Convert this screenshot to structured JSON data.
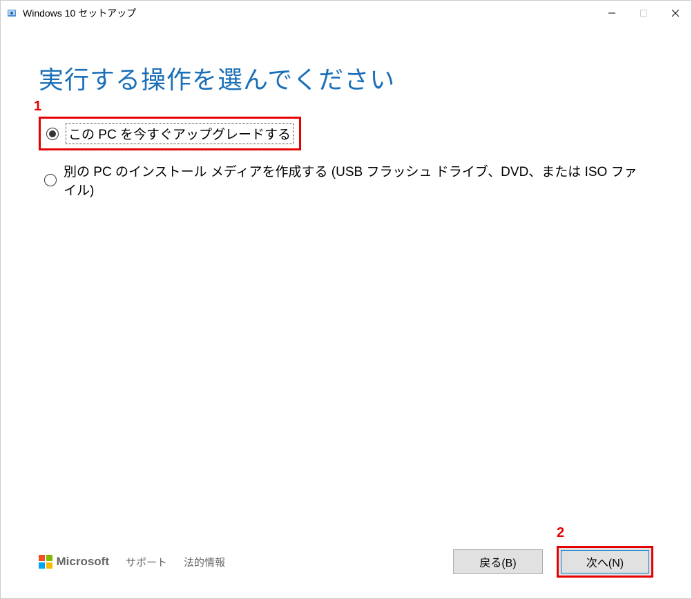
{
  "window": {
    "title": "Windows 10 セットアップ"
  },
  "content": {
    "heading": "実行する操作を選んでください",
    "options": [
      {
        "label": "この PC を今すぐアップグレードする",
        "selected": true
      },
      {
        "label": "別の PC のインストール メディアを作成する (USB フラッシュ ドライブ、DVD、または ISO ファイル)",
        "selected": false
      }
    ]
  },
  "footer": {
    "brand": "Microsoft",
    "links": {
      "support": "サポート",
      "legal": "法的情報"
    },
    "buttons": {
      "back": "戻る(B)",
      "next": "次へ(N)"
    }
  },
  "annotations": {
    "num1": "1",
    "num2": "2"
  }
}
